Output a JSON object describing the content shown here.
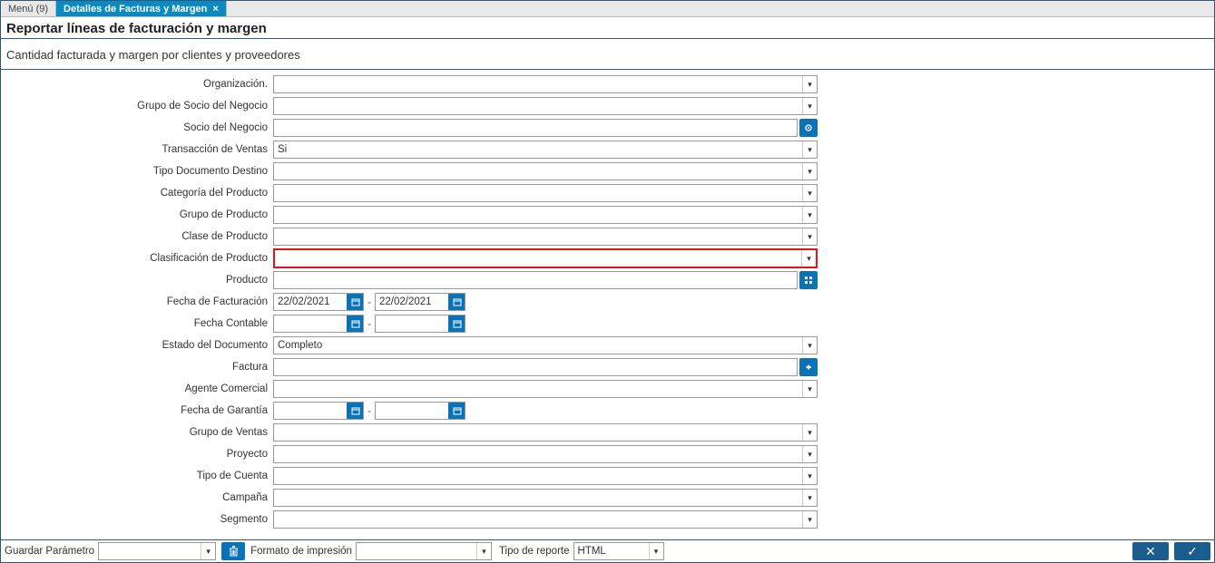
{
  "tabs": {
    "menu_label": "Menú (9)",
    "active_label": "Detalles de Facturas y Margen"
  },
  "header": {
    "title": "Reportar líneas de facturación y margen",
    "subtitle": "Cantidad facturada y margen por clientes y proveedores"
  },
  "fields": {
    "organizacion": {
      "label": "Organización.",
      "value": ""
    },
    "grupo_socio": {
      "label": "Grupo de Socio del Negocio",
      "value": ""
    },
    "socio": {
      "label": "Socio del Negocio",
      "value": ""
    },
    "trans_ventas": {
      "label": "Transacción de Ventas",
      "value": "Si"
    },
    "tipo_doc_dest": {
      "label": "Tipo Documento Destino",
      "value": ""
    },
    "cat_producto": {
      "label": "Categoría del Producto",
      "value": ""
    },
    "grupo_producto": {
      "label": "Grupo de Producto",
      "value": ""
    },
    "clase_producto": {
      "label": "Clase de Producto",
      "value": ""
    },
    "clasif_producto": {
      "label": "Clasificación de Producto",
      "value": ""
    },
    "producto": {
      "label": "Producto",
      "value": ""
    },
    "fecha_facturacion": {
      "label": "Fecha de Facturación",
      "from": "22/02/2021",
      "to": "22/02/2021"
    },
    "fecha_contable": {
      "label": "Fecha Contable",
      "from": "",
      "to": ""
    },
    "estado_doc": {
      "label": "Estado del Documento",
      "value": "Completo"
    },
    "factura": {
      "label": "Factura",
      "value": ""
    },
    "agente_comercial": {
      "label": "Agente Comercial",
      "value": ""
    },
    "fecha_garantia": {
      "label": "Fecha de Garantía",
      "from": "",
      "to": ""
    },
    "grupo_ventas": {
      "label": "Grupo de Ventas",
      "value": ""
    },
    "proyecto": {
      "label": "Proyecto",
      "value": ""
    },
    "tipo_cuenta": {
      "label": "Tipo de Cuenta",
      "value": ""
    },
    "campana": {
      "label": "Campaña",
      "value": ""
    },
    "segmento": {
      "label": "Segmento",
      "value": ""
    }
  },
  "footer": {
    "guardar_param_label": "Guardar Parámetro",
    "guardar_param_value": "",
    "formato_label": "Formato de impresión",
    "formato_value": "",
    "tipo_reporte_label": "Tipo de reporte",
    "tipo_reporte_value": "HTML"
  }
}
